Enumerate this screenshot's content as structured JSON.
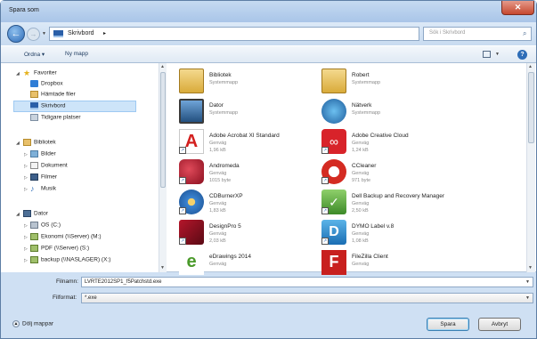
{
  "window": {
    "title": "Spara som"
  },
  "navigation": {
    "breadcrumb": "Skrivbord",
    "search_placeholder": "Sök i Skrivbord"
  },
  "toolbar": {
    "organize": "Ordna ▾",
    "new_folder": "Ny mapp"
  },
  "sidebar": {
    "favorites": {
      "label": "Favoriter",
      "items": [
        "Dropbox",
        "Hämtade filer",
        "Skrivbord",
        "Tidigare platser"
      ]
    },
    "libraries": {
      "label": "Bibliotek",
      "items": [
        "Bilder",
        "Dokument",
        "Filmer",
        "Musik"
      ]
    },
    "computer": {
      "label": "Dator",
      "items": [
        "OS (C:)",
        "Ekonomi (\\\\Server) (M:)",
        "PDF (\\\\Server) (S:)",
        "backup (\\\\NASLAGER) (X:)"
      ]
    },
    "selected": "Skrivbord"
  },
  "files": [
    {
      "name": "Bibliotek",
      "type": "Systemmapp",
      "size": "",
      "icon": "library-folder-icon"
    },
    {
      "name": "Robert",
      "type": "Systemmapp",
      "size": "",
      "icon": "user-folder-icon"
    },
    {
      "name": "Dator",
      "type": "Systemmapp",
      "size": "",
      "icon": "computer-icon"
    },
    {
      "name": "Nätverk",
      "type": "Systemmapp",
      "size": "",
      "icon": "network-icon"
    },
    {
      "name": "Adobe Acrobat XI Standard",
      "type": "Genväg",
      "size": "1,96 kB",
      "icon": "acrobat-icon"
    },
    {
      "name": "Adobe Creative Cloud",
      "type": "Genväg",
      "size": "1,24 kB",
      "icon": "creative-cloud-icon"
    },
    {
      "name": "Andromeda",
      "type": "Genväg",
      "size": "1015 byte",
      "icon": "andromeda-icon"
    },
    {
      "name": "CCleaner",
      "type": "Genväg",
      "size": "971 byte",
      "icon": "ccleaner-icon"
    },
    {
      "name": "CDBurnerXP",
      "type": "Genväg",
      "size": "1,83 kB",
      "icon": "cdburner-icon"
    },
    {
      "name": "Dell Backup and Recovery Manager",
      "type": "Genväg",
      "size": "2,50 kB",
      "icon": "dell-backup-icon"
    },
    {
      "name": "DesignPro 5",
      "type": "Genväg",
      "size": "2,03 kB",
      "icon": "designpro-icon"
    },
    {
      "name": "DYMO Label v.8",
      "type": "Genväg",
      "size": "1,08 kB",
      "icon": "dymo-icon"
    },
    {
      "name": "eDrawings 2014",
      "type": "Genväg",
      "size": "",
      "icon": "edrawings-icon"
    },
    {
      "name": "FileZilla Client",
      "type": "Genväg",
      "size": "",
      "icon": "filezilla-icon"
    }
  ],
  "form": {
    "filename_label": "Filnamn:",
    "filename_value": "LVRTE2012SP1_f5Patchstd.exe",
    "filetype_label": "Filformat:",
    "filetype_value": "*.exe"
  },
  "footer": {
    "hide_folders": "Dölj mappar",
    "save": "Spara",
    "cancel": "Avbryt"
  },
  "colors": {
    "accent": "#2e6db7",
    "selection": "#cde4f9",
    "chrome": "#cfe0f3"
  }
}
